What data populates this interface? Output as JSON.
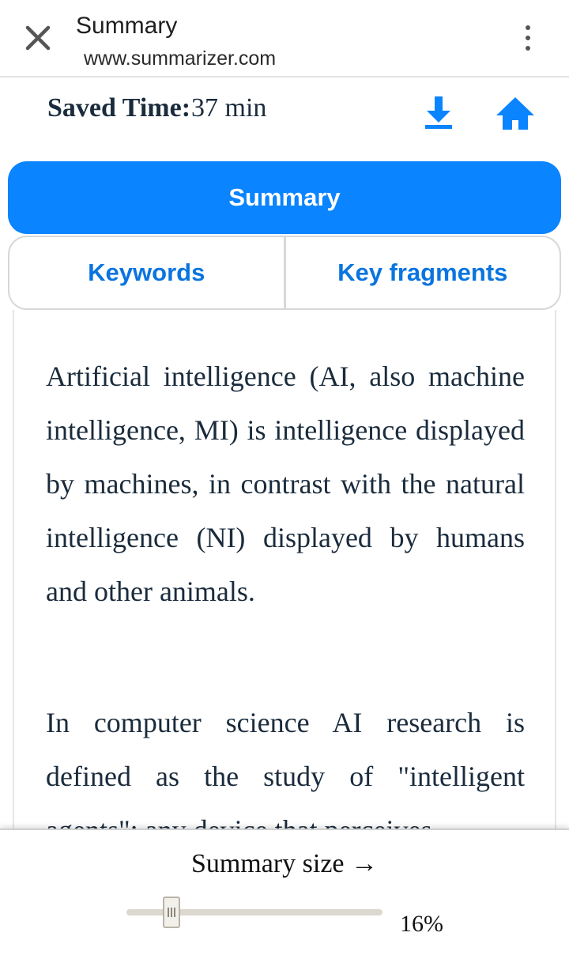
{
  "header": {
    "title": "Summary",
    "url": "www.summarizer.com"
  },
  "saved_time": {
    "label": "Saved Time:",
    "value": "37 min"
  },
  "tabs": {
    "active": "Summary",
    "keywords": "Keywords",
    "key_fragments": "Key fragments"
  },
  "content": {
    "paragraphs": [
      "Artificial intelligence (AI, also machine intelligence, MI) is intelligence displayed by machines, in contrast with the natural intelligence (NI) displayed by humans and other animals.",
      "In computer science AI research is defined as the study of \"intelligent agents\": any device that perceives"
    ]
  },
  "summary_size": {
    "label": "Summary size →",
    "value_text": "16%",
    "value": 0.16
  },
  "icons": {
    "close": "close-icon",
    "menu": "more-vertical-icon",
    "download": "download-icon",
    "home": "home-icon"
  },
  "colors": {
    "accent": "#0a84ff",
    "tab_text": "#0a74e0",
    "body_text": "#1a2b3c"
  }
}
